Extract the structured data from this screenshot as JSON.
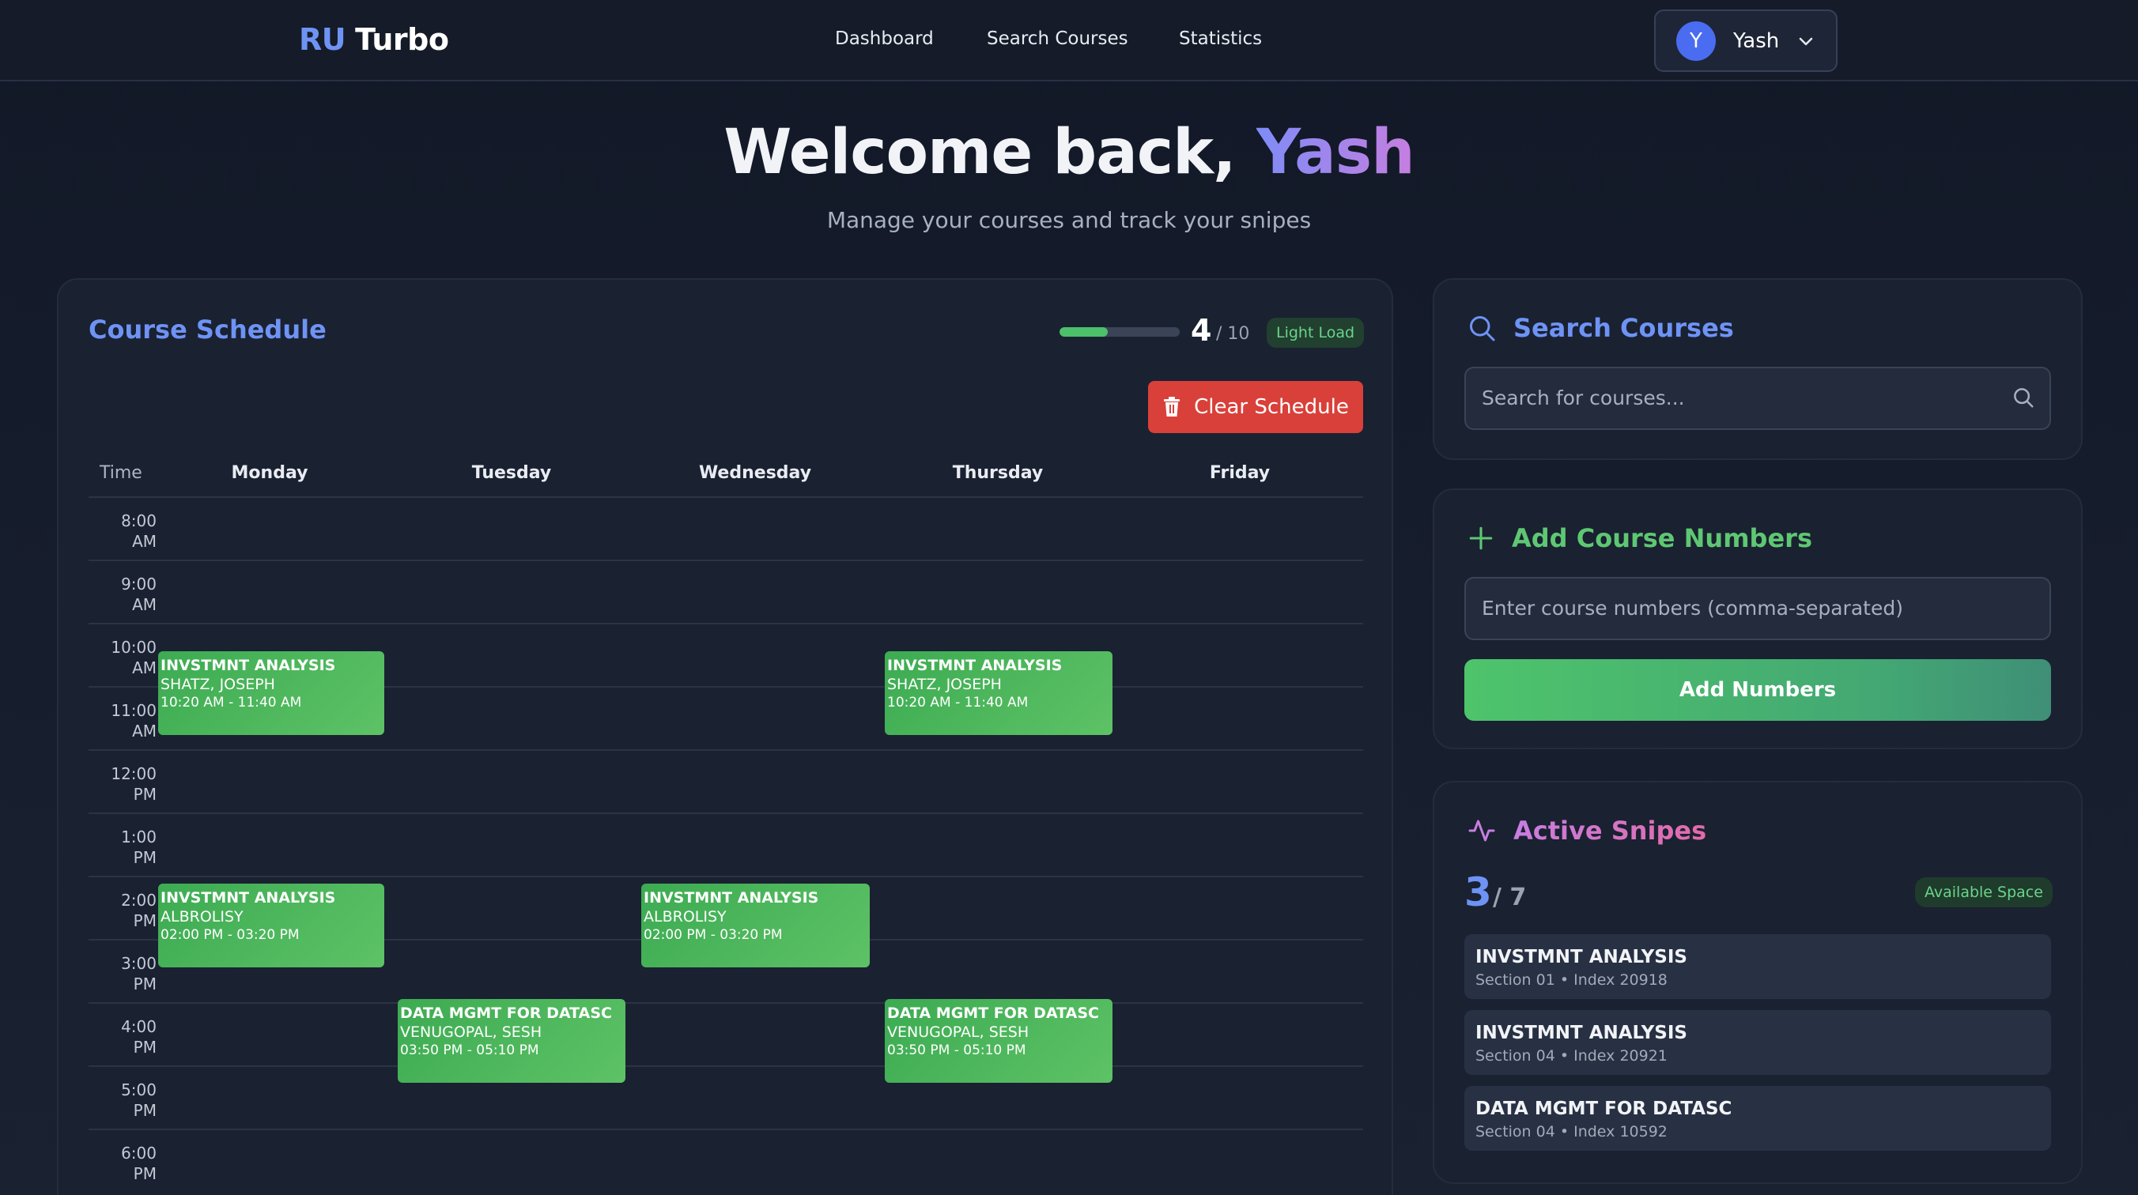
{
  "header": {
    "logo_ru": "RU",
    "logo_turbo": "Turbo",
    "nav": [
      "Dashboard",
      "Search Courses",
      "Statistics"
    ],
    "user_initial": "Y",
    "user_name": "Yash"
  },
  "welcome": {
    "prefix": "Welcome back, ",
    "name": "Yash",
    "subtitle": "Manage your courses and track your snipes"
  },
  "schedule": {
    "title": "Course Schedule",
    "load_count": "4",
    "load_total": "/ 10",
    "load_fraction": 0.4,
    "load_badge": "Light Load",
    "clear_label": "Clear Schedule",
    "time_header": "Time",
    "days": [
      "Monday",
      "Tuesday",
      "Wednesday",
      "Thursday",
      "Friday"
    ],
    "times": [
      [
        "8:00",
        "AM"
      ],
      [
        "9:00",
        "AM"
      ],
      [
        "10:00",
        "AM"
      ],
      [
        "11:00",
        "AM"
      ],
      [
        "12:00",
        "PM"
      ],
      [
        "1:00",
        "PM"
      ],
      [
        "2:00",
        "PM"
      ],
      [
        "3:00",
        "PM"
      ],
      [
        "4:00",
        "PM"
      ],
      [
        "5:00",
        "PM"
      ],
      [
        "6:00",
        "PM"
      ]
    ],
    "events": [
      {
        "title": "INVSTMNT ANALYSIS",
        "instructor": "SHATZ, JOSEPH",
        "time": "10:20 AM - 11:40 AM"
      },
      {
        "title": "INVSTMNT ANALYSIS",
        "instructor": "SHATZ, JOSEPH",
        "time": "10:20 AM - 11:40 AM"
      },
      {
        "title": "INVSTMNT ANALYSIS",
        "instructor": "ALBROLISY",
        "time": "02:00 PM - 03:20 PM"
      },
      {
        "title": "INVSTMNT ANALYSIS",
        "instructor": "ALBROLISY",
        "time": "02:00 PM - 03:20 PM"
      },
      {
        "title": "DATA MGMT FOR DATASC",
        "instructor": "VENUGOPAL, SESH",
        "time": "03:50 PM - 05:10 PM"
      },
      {
        "title": "DATA MGMT FOR DATASC",
        "instructor": "VENUGOPAL, SESH",
        "time": "03:50 PM - 05:10 PM"
      }
    ]
  },
  "search": {
    "title": "Search Courses",
    "placeholder": "Search for courses..."
  },
  "add_numbers": {
    "title": "Add Course Numbers",
    "placeholder": "Enter course numbers (comma-separated)",
    "button": "Add Numbers"
  },
  "snipes": {
    "title": "Active Snipes",
    "count": "3",
    "total": "/ 7",
    "badge": "Available Space",
    "items": [
      {
        "name": "INVSTMNT ANALYSIS",
        "meta": "Section 01 • Index 20918"
      },
      {
        "name": "INVSTMNT ANALYSIS",
        "meta": "Section 04 • Index 20921"
      },
      {
        "name": "DATA MGMT FOR DATASC",
        "meta": "Section 04 • Index 10592"
      }
    ]
  },
  "colors": {
    "accent_blue": "#6e93f5",
    "event_green": "#4cb85f",
    "danger_red": "#d9403a",
    "snipes_pink": "#c77ee0"
  }
}
